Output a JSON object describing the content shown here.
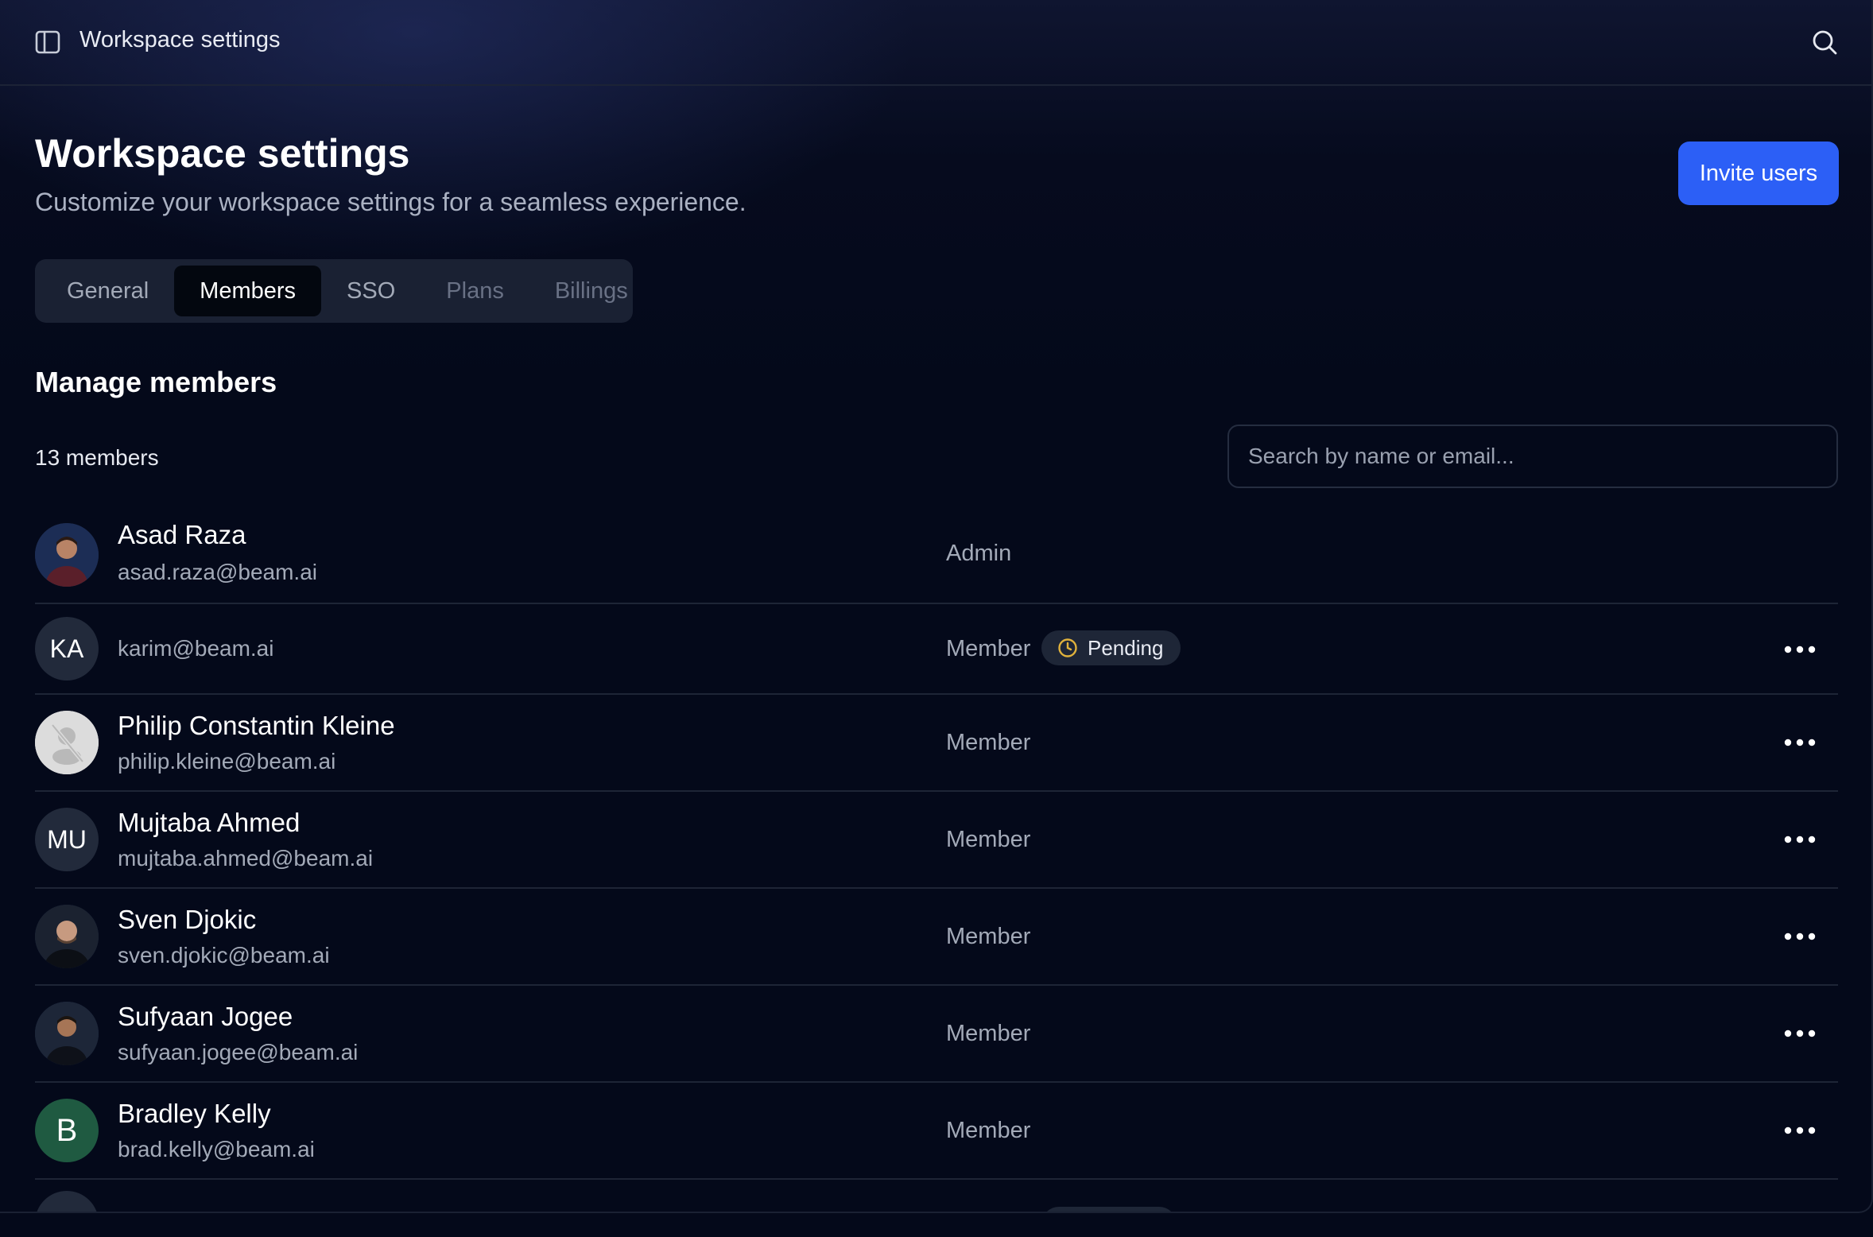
{
  "topbar": {
    "title": "Workspace settings",
    "sidebar_icon": "sidebar-panel-icon",
    "search_icon": "search-icon"
  },
  "header": {
    "title": "Workspace settings",
    "subtitle": "Customize your workspace settings for a seamless experience.",
    "invite_label": "Invite users"
  },
  "tabs": [
    {
      "label": "General",
      "state": "normal"
    },
    {
      "label": "Members",
      "state": "active"
    },
    {
      "label": "SSO",
      "state": "normal"
    },
    {
      "label": "Plans",
      "state": "muted"
    },
    {
      "label": "Billings",
      "state": "muted"
    }
  ],
  "members_section": {
    "title": "Manage members",
    "count_label": "13 members",
    "search_placeholder": "Search by name or email..."
  },
  "members": [
    {
      "name": "Asad Raza",
      "email": "asad.raza@beam.ai",
      "role": "Admin",
      "avatar": "photo"
    },
    {
      "name": "",
      "email": "karim@beam.ai",
      "role": "Member",
      "avatar": "KA",
      "badge": "Pending"
    },
    {
      "name": "Philip Constantin Kleine",
      "email": "philip.kleine@beam.ai",
      "role": "Member",
      "avatar": "blank"
    },
    {
      "name": "Mujtaba Ahmed",
      "email": "mujtaba.ahmed@beam.ai",
      "role": "Member",
      "avatar": "MU"
    },
    {
      "name": "Sven Djokic",
      "email": "sven.djokic@beam.ai",
      "role": "Member",
      "avatar": "photo"
    },
    {
      "name": "Sufyaan Jogee",
      "email": "sufyaan.jogee@beam.ai",
      "role": "Member",
      "avatar": "photo"
    },
    {
      "name": "Bradley Kelly",
      "email": "brad.kelly@beam.ai",
      "role": "Member",
      "avatar": "B"
    }
  ],
  "colors": {
    "accent": "#2c5ff6",
    "background": "#04091a",
    "pending_icon": "#e0b23c",
    "avatar_green": "#1f5a41"
  }
}
